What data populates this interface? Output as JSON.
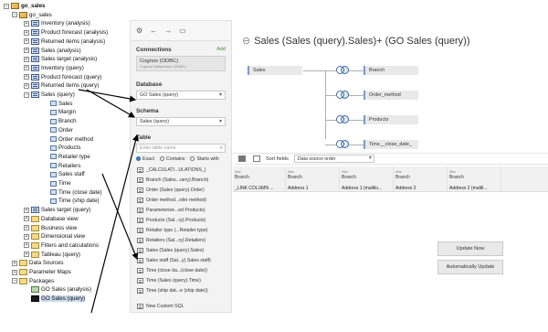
{
  "tree": {
    "root": "go_sales",
    "nodes": [
      {
        "label": "go_sales",
        "level": 1,
        "exp": "−",
        "icon": "cube"
      },
      {
        "label": "Inventory (analysis)",
        "level": 2,
        "exp": "+",
        "icon": "qs"
      },
      {
        "label": "Product forecast (analysis)",
        "level": 2,
        "exp": "+",
        "icon": "qs"
      },
      {
        "label": "Returned items (analysis)",
        "level": 2,
        "exp": "+",
        "icon": "qs"
      },
      {
        "label": "Sales (analysis)",
        "level": 2,
        "exp": "+",
        "icon": "qs"
      },
      {
        "label": "Sales target (analysis)",
        "level": 2,
        "exp": "+",
        "icon": "qs"
      },
      {
        "label": "Inventory (query)",
        "level": 2,
        "exp": "+",
        "icon": "qs"
      },
      {
        "label": "Product forecast (query)",
        "level": 2,
        "exp": "+",
        "icon": "qs"
      },
      {
        "label": "Returned items (query)",
        "level": 2,
        "exp": "+",
        "icon": "qs"
      },
      {
        "label": "Sales (query)",
        "level": 2,
        "exp": "−",
        "icon": "qs"
      },
      {
        "label": "Sales",
        "level": 3,
        "exp": "",
        "icon": "fld"
      },
      {
        "label": "Margin",
        "level": 3,
        "exp": "",
        "icon": "fld"
      },
      {
        "label": "Branch",
        "level": 3,
        "exp": "",
        "icon": "fld"
      },
      {
        "label": "Order",
        "level": 3,
        "exp": "",
        "icon": "fld"
      },
      {
        "label": "Order method",
        "level": 3,
        "exp": "",
        "icon": "fld"
      },
      {
        "label": "Products",
        "level": 3,
        "exp": "",
        "icon": "fld"
      },
      {
        "label": "Retailer type",
        "level": 3,
        "exp": "",
        "icon": "fld"
      },
      {
        "label": "Retailers",
        "level": 3,
        "exp": "",
        "icon": "fld"
      },
      {
        "label": "Sales staff",
        "level": 3,
        "exp": "",
        "icon": "fld"
      },
      {
        "label": "Time",
        "level": 3,
        "exp": "",
        "icon": "fld"
      },
      {
        "label": "Time (close date)",
        "level": 3,
        "exp": "",
        "icon": "fld"
      },
      {
        "label": "Time (ship date)",
        "level": 3,
        "exp": "",
        "icon": "fld"
      },
      {
        "label": "Sales target (query)",
        "level": 2,
        "exp": "+",
        "icon": "qs"
      },
      {
        "label": "Database view",
        "level": 2,
        "exp": "+",
        "icon": "folder"
      },
      {
        "label": "Business view",
        "level": 2,
        "exp": "+",
        "icon": "folder"
      },
      {
        "label": "Dimensional view",
        "level": 2,
        "exp": "+",
        "icon": "folder"
      },
      {
        "label": "Filters and calculations",
        "level": 2,
        "exp": "+",
        "icon": "folder"
      },
      {
        "label": "Tableau (query)",
        "level": 2,
        "exp": "+",
        "icon": "folder"
      },
      {
        "label": "Data Sources",
        "level": 1,
        "exp": "+",
        "icon": "folder"
      },
      {
        "label": "Parameter Maps",
        "level": 1,
        "exp": "+",
        "icon": "folder"
      },
      {
        "label": "Packages",
        "level": 1,
        "exp": "−",
        "icon": "folder"
      },
      {
        "label": "GO Sales (analysis)",
        "level": 2,
        "exp": "",
        "icon": "pkg"
      },
      {
        "label": "GO Sales (query)",
        "level": 2,
        "exp": "",
        "icon": "sel"
      }
    ]
  },
  "middle": {
    "connections_title": "Connections",
    "add_label": "Add",
    "connection_name": "Cognos (ODBC)",
    "connection_sub": "Cognos Datasource (ODBC)",
    "database_title": "Database",
    "database_value": "GO Sales (query)",
    "schema_title": "Schema",
    "schema_value": "Sales (query)",
    "table_title": "Table",
    "table_placeholder": "Enter table name",
    "radio_exact": "Exact",
    "radio_contains": "Contains",
    "radio_starts": "Starts with",
    "tables": [
      "_CALCULATI...ULATIONS_)",
      "Branch (Sales...uery).Branch)",
      "Order (Sales (query).Order)",
      "Order method...rder method)",
      "Parameterize...ed Products)",
      "Products (Sal...ry).Products)",
      "Retailer type (...Retailer type)",
      "Retailers (Sal...ry).Retailers)",
      "Sales (Sales (query).Sales)",
      "Sales staff (Sal...y).Sales staff)",
      "Time (close da...(close date))",
      "Time (Sales (query).Time)",
      "Time (ship dat...e (ship date))"
    ],
    "new_sql": "New Custom SQL"
  },
  "canvas": {
    "title": "Sales (Sales (query).Sales)+ (GO Sales (query))",
    "left_table": "Sales",
    "join_tables": [
      "Branch",
      "Order_method",
      "Products",
      "Time__close_date_"
    ],
    "sort_label": "Sort fields",
    "sort_value": "Data source order",
    "columns": [
      {
        "type": "Abc",
        "name": "Branch",
        "header": "_LINK COLUMN ..."
      },
      {
        "type": "Abc",
        "name": "Branch",
        "header": "Address 1"
      },
      {
        "type": "Abc",
        "name": "Branch",
        "header": "Address 1 (multilo..."
      },
      {
        "type": "Abc",
        "name": "Branch",
        "header": "Address 2"
      },
      {
        "type": "Abc",
        "name": "Branch",
        "header": "Address 2 (multil..."
      }
    ],
    "update_now": "Update Now",
    "auto_update": "Automatically Update"
  },
  "colors": {
    "accent": "#3b82c4",
    "join": "#3b6aa3",
    "link": "#4a8a3a"
  }
}
